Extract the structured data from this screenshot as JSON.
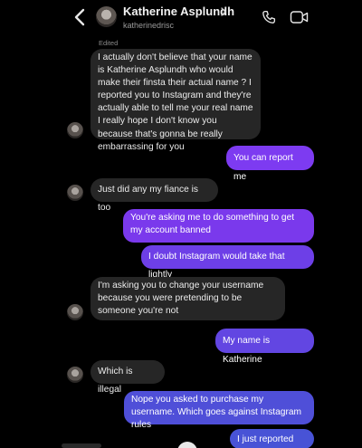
{
  "header": {
    "name": "Katherine Asplundh",
    "username": "katherinedrisc"
  },
  "edited_label": "Edited",
  "messages": [
    {
      "side": "in",
      "text": "I actually don't believe that your name is Katherine Asplundh who would make their finsta their actual name ? I reported you to Instagram and they're actually able to tell me your real name I really hope I don't know you because that's gonna be really embarrassing for you"
    },
    {
      "side": "out",
      "text": "You can report me",
      "color": "#7d3bf1"
    },
    {
      "side": "in",
      "text": "Just did any my fiance is too"
    },
    {
      "side": "out",
      "text": "You're asking me to do something to get my account banned",
      "color": "#7a39ec"
    },
    {
      "side": "out",
      "text": "I doubt Instagram would take that lightly",
      "color": "#6d3fe7"
    },
    {
      "side": "in",
      "text": "I'm asking you to change your username because you were pretending to be someone you're not"
    },
    {
      "side": "out",
      "text": "My name is Katherine",
      "color": "#6246e2"
    },
    {
      "side": "in",
      "text": "Which is illegal"
    },
    {
      "side": "out",
      "text": "Nope you asked to purchase my username. Which goes against Instagram rules",
      "color": "#4f4fd8"
    },
    {
      "side": "out",
      "text": "I just reported you",
      "color": "#4853d6"
    }
  ],
  "colors": {
    "background": "#000000",
    "incoming_bubble": "#262626"
  }
}
